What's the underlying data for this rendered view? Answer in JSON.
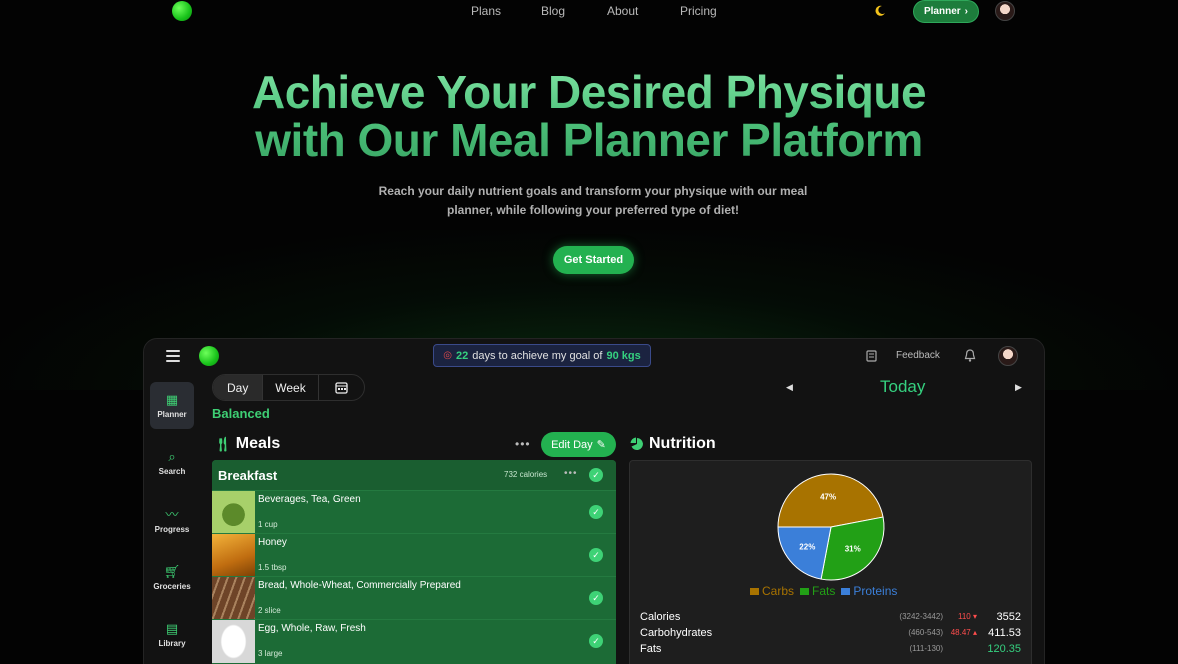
{
  "nav": {
    "links": [
      "Plans",
      "Blog",
      "About",
      "Pricing"
    ],
    "planner_label": "Planner"
  },
  "hero": {
    "title_line1": "Achieve Your Desired Physique",
    "title_line2": "with Our Meal Planner Platform",
    "subtitle": "Reach your daily nutrient goals and transform your physique with our meal planner, while following your preferred type of diet!",
    "cta": "Get Started"
  },
  "app": {
    "goal": {
      "days": "22",
      "text_mid": "days to achieve my goal of",
      "target": "90 kgs"
    },
    "feedback": "Feedback",
    "sidebar": [
      {
        "label": "Planner",
        "icon": "calendar-icon"
      },
      {
        "label": "Search",
        "icon": "search-icon"
      },
      {
        "label": "Progress",
        "icon": "chart-icon"
      },
      {
        "label": "Groceries",
        "icon": "cart-icon"
      },
      {
        "label": "Library",
        "icon": "book-icon"
      }
    ],
    "view_tabs": {
      "day": "Day",
      "week": "Week"
    },
    "diet": "Balanced",
    "date_label": "Today",
    "meals": {
      "heading": "Meals",
      "edit_day": "Edit Day",
      "meal_name": "Breakfast",
      "meal_calories": "732 calories",
      "items": [
        {
          "name": "Beverages, Tea, Green",
          "qty": "1 cup",
          "color": "#7aa84a"
        },
        {
          "name": "Honey",
          "qty": "1.5 tbsp",
          "color": "#d98a1e"
        },
        {
          "name": "Bread, Whole-Wheat, Commercially Prepared",
          "qty": "2 slice",
          "color": "#8a5a3a"
        },
        {
          "name": "Egg, Whole, Raw, Fresh",
          "qty": "3 large",
          "color": "#e8e8e8"
        }
      ]
    },
    "nutrition": {
      "heading": "Nutrition",
      "legend": [
        "Carbs",
        "Fats",
        "Proteins"
      ],
      "rows": [
        {
          "label": "Calories",
          "range": "(3242-3442)",
          "delta": "110 ▾",
          "value": "3552",
          "good": false
        },
        {
          "label": "Carbohydrates",
          "range": "(460-543)",
          "delta": "48.47 ▴",
          "value": "411.53",
          "good": false
        },
        {
          "label": "Fats",
          "range": "(111-130)",
          "delta": "",
          "value": "120.35",
          "good": true
        }
      ]
    }
  },
  "chart_data": {
    "type": "pie",
    "categories": [
      "Carbs",
      "Fats",
      "Proteins"
    ],
    "values": [
      47,
      31,
      22
    ],
    "labels": [
      "47%",
      "31%",
      "22%"
    ],
    "colors": [
      "#a87300",
      "#22a016",
      "#3b7fd9"
    ],
    "legend_position": "bottom"
  }
}
